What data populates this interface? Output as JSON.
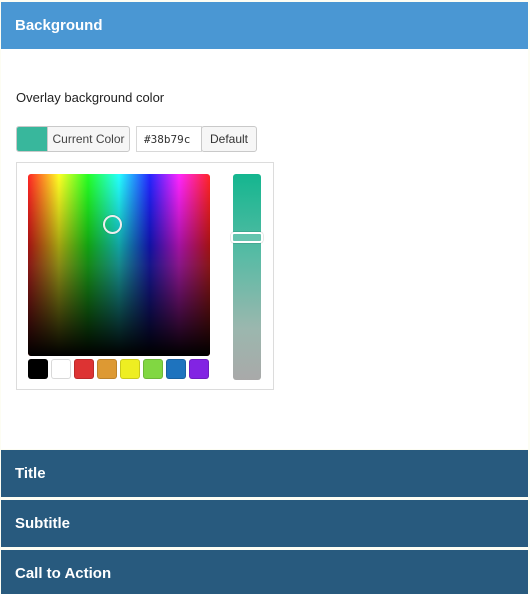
{
  "sections": {
    "background": "Background",
    "title": "Title",
    "subtitle": "Subtitle",
    "call_to_action": "Call to Action"
  },
  "background_panel": {
    "overlay_label": "Overlay background color",
    "current_color_label": "Current Color",
    "hex_value": "#38b79c",
    "default_label": "Default"
  },
  "colors": {
    "active_header": "#4a97d3",
    "inactive_header": "#285a7e",
    "current_color": "#38b79c"
  },
  "palette": [
    "#000000",
    "#ffffff",
    "#dd3333",
    "#dd9933",
    "#eeee22",
    "#81d742",
    "#1e73be",
    "#8224e3"
  ]
}
